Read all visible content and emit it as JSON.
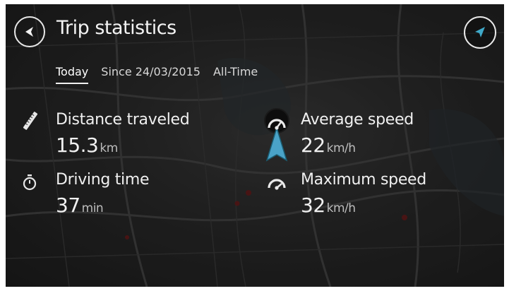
{
  "header": {
    "title": "Trip statistics"
  },
  "tabs": [
    {
      "label": "Today",
      "active": true
    },
    {
      "label": "Since 24/03/2015",
      "active": false
    },
    {
      "label": "All-Time",
      "active": false
    }
  ],
  "stats": {
    "distance": {
      "label": "Distance traveled",
      "value": "15.3",
      "unit": "km",
      "icon": "ruler-icon"
    },
    "driving_time": {
      "label": "Driving time",
      "value": "37",
      "unit": "min",
      "icon": "stopwatch-icon"
    },
    "average_speed": {
      "label": "Average speed",
      "value": "22",
      "unit": "km/h",
      "icon": "speedometer-icon"
    },
    "maximum_speed": {
      "label": "Maximum speed",
      "value": "32",
      "unit": "km/h",
      "icon": "speedometer-icon"
    }
  },
  "colors": {
    "accent": "#3fa9c9",
    "text": "#f0f0f0",
    "background": "#262626"
  }
}
